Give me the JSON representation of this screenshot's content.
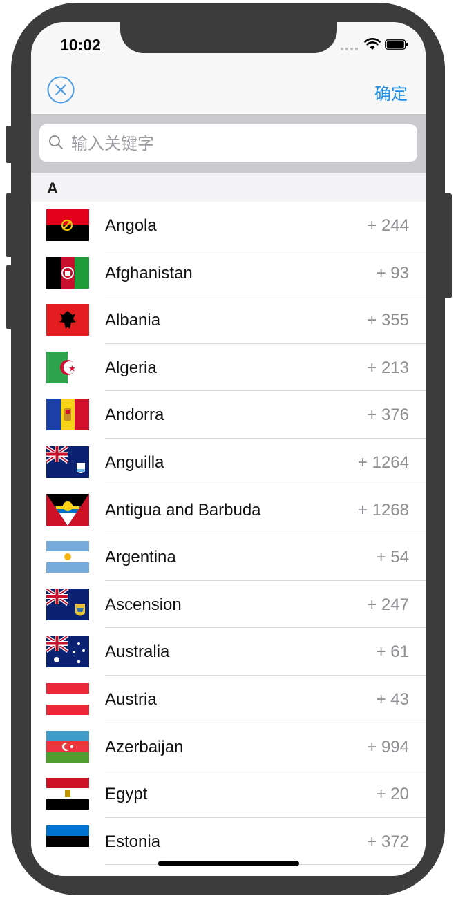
{
  "status_bar": {
    "time": "10:02"
  },
  "nav": {
    "close_icon": "close-circle-icon",
    "confirm_label": "确定",
    "accent_color": "#1e8ee8"
  },
  "search": {
    "placeholder": "输入关键字"
  },
  "section": {
    "letter": "A"
  },
  "countries": [
    {
      "name": "Angola",
      "code": "+ 244",
      "flag": "angola"
    },
    {
      "name": "Afghanistan",
      "code": "+ 93",
      "flag": "afghanistan"
    },
    {
      "name": "Albania",
      "code": "+ 355",
      "flag": "albania"
    },
    {
      "name": "Algeria",
      "code": "+ 213",
      "flag": "algeria"
    },
    {
      "name": "Andorra",
      "code": "+ 376",
      "flag": "andorra"
    },
    {
      "name": "Anguilla",
      "code": "+ 1264",
      "flag": "anguilla"
    },
    {
      "name": "Antigua and Barbuda",
      "code": "+ 1268",
      "flag": "antigua"
    },
    {
      "name": "Argentina",
      "code": "+ 54",
      "flag": "argentina"
    },
    {
      "name": "Ascension",
      "code": "+ 247",
      "flag": "ascension"
    },
    {
      "name": "Australia",
      "code": "+ 61",
      "flag": "australia"
    },
    {
      "name": "Austria",
      "code": "+ 43",
      "flag": "austria"
    },
    {
      "name": "Azerbaijan",
      "code": "+ 994",
      "flag": "azerbaijan"
    },
    {
      "name": "Egypt",
      "code": "+ 20",
      "flag": "egypt"
    },
    {
      "name": "Estonia",
      "code": "+ 372",
      "flag": "estonia"
    }
  ]
}
